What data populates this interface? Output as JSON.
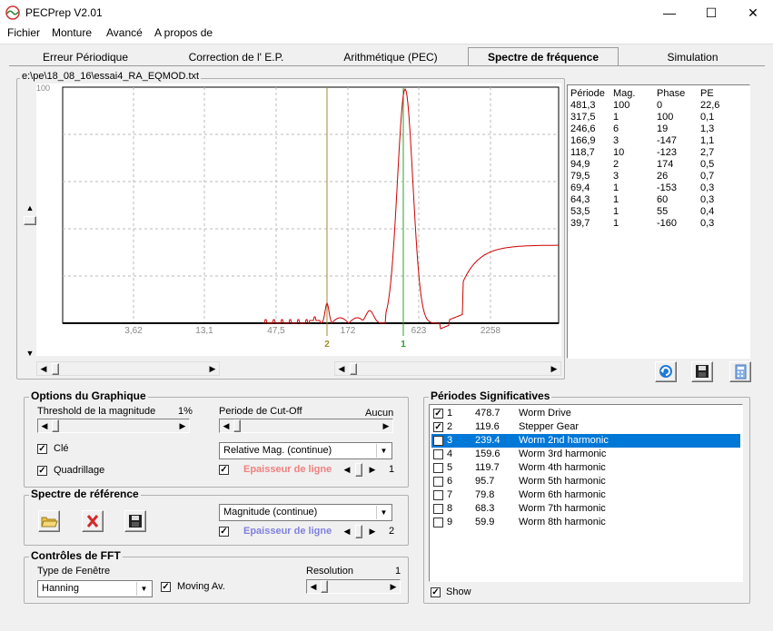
{
  "window": {
    "title": "PECPrep V2.01"
  },
  "menu": [
    "Fichier",
    "Monture",
    "Avancé",
    "A propos de"
  ],
  "tabs": [
    "Erreur Périodique",
    "Correction de l' E.P.",
    "Arithmétique (PEC)",
    "Spectre de fréquence",
    "Simulation"
  ],
  "active_tab": 3,
  "file_path": "e:\\pe\\18_08_16\\essai4_RA_EQMOD.txt",
  "chart": {
    "ytop_label": "100",
    "x_ticks": [
      "3,62",
      "13,1",
      "47,5",
      "172",
      "623",
      "2258"
    ],
    "markers": [
      {
        "label": "2",
        "color": "#a08c2c"
      },
      {
        "label": "1",
        "color": "#2ca02c"
      }
    ]
  },
  "chart_data": {
    "type": "line",
    "xscale": "log",
    "x_ticks": [
      "3,62",
      "13,1",
      "47,5",
      "172",
      "623",
      "2258"
    ],
    "series": [
      {
        "color": "#cc0000"
      }
    ]
  },
  "period_table": {
    "headers": [
      "Période",
      "Mag.",
      "Phase",
      "PE"
    ],
    "rows": [
      [
        "481,3",
        "100",
        "0",
        "22,6"
      ],
      [
        "317,5",
        "1",
        "100",
        "0,1"
      ],
      [
        "246,6",
        "6",
        "19",
        "1,3"
      ],
      [
        "166,9",
        "3",
        "-147",
        "1,1"
      ],
      [
        "118,7",
        "10",
        "-123",
        "2,7"
      ],
      [
        "94,9",
        "2",
        "174",
        "0,5"
      ],
      [
        "79,5",
        "3",
        "26",
        "0,7"
      ],
      [
        "69,4",
        "1",
        "-153",
        "0,3"
      ],
      [
        "64,3",
        "1",
        "60",
        "0,3"
      ],
      [
        "53,5",
        "1",
        "55",
        "0,4"
      ],
      [
        "39,7",
        "1",
        "-160",
        "0,3"
      ]
    ]
  },
  "options": {
    "title": "Options du Graphique",
    "threshold_label": "Threshold de la magnitude",
    "threshold_value": "1%",
    "cutoff_label": "Periode de Cut-Off",
    "cutoff_value": "Aucun",
    "cle_label": "Clé",
    "grid_label": "Quadrillage",
    "mag_combo": "Relative Mag. (continue)",
    "line_label": "Epaisseur de ligne",
    "line_value": "1",
    "line_color": "#f08080"
  },
  "reference": {
    "title": "Spectre de référence",
    "combo": "Magnitude (continue)",
    "line_label": "Epaisseur de ligne",
    "line_value": "2",
    "line_color": "#8080e0"
  },
  "fft": {
    "title": "Contrôles de FFT",
    "window_label": "Type de Fenêtre",
    "window_value": "Hanning",
    "moving_label": "Moving Av.",
    "resolution_label": "Resolution",
    "resolution_value": "1"
  },
  "significant": {
    "title": "Périodes Significatives",
    "rows": [
      {
        "n": "1",
        "period": "478.7",
        "name": "Worm Drive",
        "checked": true
      },
      {
        "n": "2",
        "period": "119.6",
        "name": "Stepper Gear",
        "checked": true
      },
      {
        "n": "3",
        "period": "239.4",
        "name": "Worm 2nd harmonic",
        "checked": false,
        "selected": true
      },
      {
        "n": "4",
        "period": "159.6",
        "name": "Worm 3rd harmonic",
        "checked": false
      },
      {
        "n": "5",
        "period": "119.7",
        "name": "Worm 4th harmonic",
        "checked": false
      },
      {
        "n": "6",
        "period": "95.7",
        "name": "Worm 5th harmonic",
        "checked": false
      },
      {
        "n": "7",
        "period": "79.8",
        "name": "Worm 6th harmonic",
        "checked": false
      },
      {
        "n": "8",
        "period": "68.3",
        "name": "Worm 7th harmonic",
        "checked": false
      },
      {
        "n": "9",
        "period": "59.9",
        "name": "Worm 8th harmonic",
        "checked": false
      }
    ],
    "show_label": "Show"
  }
}
